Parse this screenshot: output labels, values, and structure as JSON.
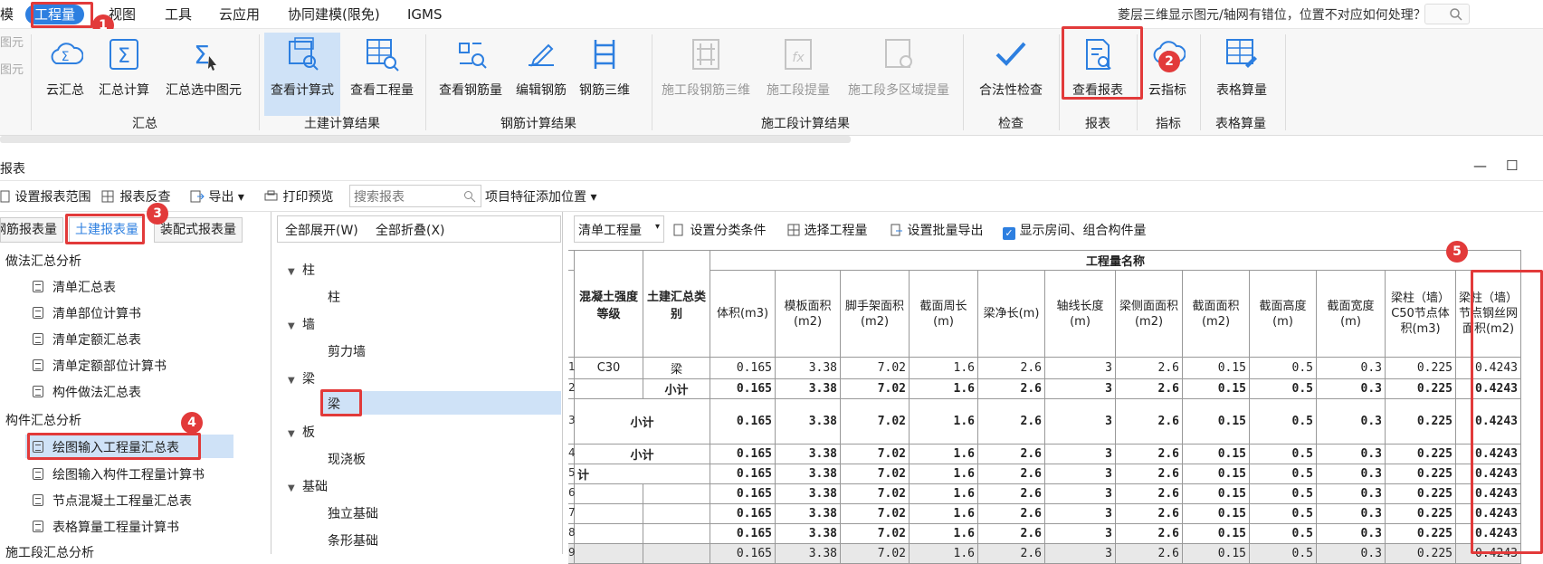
{
  "menubar": {
    "items": [
      "模",
      "工程量",
      "视图",
      "工具",
      "云应用",
      "协同建模(限免)",
      "IGMS"
    ],
    "active_index": 1,
    "notice": "菱层三维显示图元/轴网有错位，位置不对应如何处理？"
  },
  "ribbon": {
    "left_stub": [
      "图元",
      "图元"
    ],
    "buttons": [
      {
        "label": "云汇总",
        "icon": "cloud-sigma-icon"
      },
      {
        "label": "汇总计算",
        "icon": "sigma-icon"
      },
      {
        "label": "汇总选中图元",
        "icon": "sigma-select-icon"
      },
      {
        "label": "查看计算式",
        "icon": "formula-view-icon"
      },
      {
        "label": "查看工程量",
        "icon": "quantity-view-icon"
      },
      {
        "label": "查看钢筋量",
        "icon": "rebar-view-icon"
      },
      {
        "label": "编辑钢筋",
        "icon": "rebar-edit-icon"
      },
      {
        "label": "钢筋三维",
        "icon": "rebar-3d-icon"
      },
      {
        "label": "施工段钢筋三维",
        "icon": "stage-rebar-3d-icon"
      },
      {
        "label": "施工段提量",
        "icon": "stage-fx-icon"
      },
      {
        "label": "施工段多区域提量",
        "icon": "stage-multi-icon"
      },
      {
        "label": "合法性检查",
        "icon": "check-icon"
      },
      {
        "label": "查看报表",
        "icon": "report-icon"
      },
      {
        "label": "云指标",
        "icon": "cloud-index-icon"
      },
      {
        "label": "表格算量",
        "icon": "table-calc-icon"
      }
    ],
    "groups": [
      "汇总",
      "土建计算结果",
      "钢筋计算结果",
      "施工段计算结果",
      "检查",
      "报表",
      "指标",
      "表格算量"
    ]
  },
  "badges": [
    "1",
    "2",
    "3",
    "4",
    "5"
  ],
  "window": {
    "title": "报表",
    "controls": [
      "—",
      "☐"
    ]
  },
  "toolbar": {
    "items": [
      "设置报表范围",
      "报表反查",
      "导出",
      "打印预览"
    ],
    "search_placeholder": "搜索报表",
    "extra": "项目特征添加位置"
  },
  "report_tabs": [
    "钢筋报表量",
    "土建报表量",
    "装配式报表量"
  ],
  "report_tree": {
    "groups": [
      {
        "title": "做法汇总分析",
        "items": [
          "清单汇总表",
          "清单部位计算书",
          "清单定额汇总表",
          "清单定额部位计算书",
          "构件做法汇总表"
        ]
      },
      {
        "title": "构件汇总分析",
        "items": [
          "绘图输入工程量汇总表",
          "绘图输入构件工程量计算书",
          "节点混凝土工程量汇总表",
          "表格算量工程量计算书"
        ]
      }
    ],
    "selected": "绘图输入工程量汇总表",
    "bottom_cut": "施工段汇总分析"
  },
  "component_tree": {
    "expand_all": "全部展开(W)",
    "collapse_all": "全部折叠(X)",
    "nodes": [
      {
        "name": "柱",
        "children": [
          "柱"
        ]
      },
      {
        "name": "墙",
        "children": [
          "剪力墙"
        ]
      },
      {
        "name": "梁",
        "children": [
          "梁"
        ]
      },
      {
        "name": "板",
        "children": [
          "现浇板"
        ]
      },
      {
        "name": "基础",
        "children": [
          "独立基础",
          "条形基础"
        ]
      }
    ]
  },
  "table_toolbar": {
    "dropdown": "清单工程量",
    "set_category": "设置分类条件",
    "select_qty": "选择工程量",
    "batch_export": "设置批量导出",
    "show_rooms": "显示房间、组合构件量"
  },
  "table": {
    "group_header": "工程量名称",
    "col0": "混凝土强度等级",
    "col1": "土建汇总类别",
    "columns": [
      "体积(m3)",
      "模板面积(m2)",
      "脚手架面积(m2)",
      "截面周长(m)",
      "梁净长(m)",
      "轴线长度(m)",
      "梁侧面面积(m2)",
      "截面面积(m2)",
      "截面高度(m)",
      "截面宽度(m)",
      "梁柱（墙）C50节点体积(m3)",
      "梁柱（墙）节点钢丝网面积(m2)"
    ],
    "rows": [
      {
        "n": "1",
        "c0": "C30",
        "c1": "梁",
        "v": [
          "0.165",
          "3.38",
          "7.02",
          "1.6",
          "2.6",
          "3",
          "2.6",
          "0.15",
          "0.5",
          "0.3",
          "0.225",
          "0.4243"
        ],
        "bold": false
      },
      {
        "n": "2",
        "c0": "",
        "c1": "小计",
        "v": [
          "0.165",
          "3.38",
          "7.02",
          "1.6",
          "2.6",
          "3",
          "2.6",
          "0.15",
          "0.5",
          "0.3",
          "0.225",
          "0.4243"
        ],
        "bold": true
      },
      {
        "n": "3",
        "c0": "小计",
        "c1": "",
        "v": [
          "0.165",
          "3.38",
          "7.02",
          "1.6",
          "2.6",
          "3",
          "2.6",
          "0.15",
          "0.5",
          "0.3",
          "0.225",
          "0.4243"
        ],
        "bold": true
      },
      {
        "n": "4",
        "c0": "小计",
        "c1": "",
        "v": [
          "0.165",
          "3.38",
          "7.02",
          "1.6",
          "2.6",
          "3",
          "2.6",
          "0.15",
          "0.5",
          "0.3",
          "0.225",
          "0.4243"
        ],
        "bold": true
      },
      {
        "n": "5",
        "c0": "计",
        "c1": "",
        "v": [
          "0.165",
          "3.38",
          "7.02",
          "1.6",
          "2.6",
          "3",
          "2.6",
          "0.15",
          "0.5",
          "0.3",
          "0.225",
          "0.4243"
        ],
        "bold": true
      },
      {
        "n": "6",
        "c0": "",
        "c1": "",
        "v": [
          "0.165",
          "3.38",
          "7.02",
          "1.6",
          "2.6",
          "3",
          "2.6",
          "0.15",
          "0.5",
          "0.3",
          "0.225",
          "0.4243"
        ],
        "bold": true
      },
      {
        "n": "7",
        "c0": "",
        "c1": "",
        "v": [
          "0.165",
          "3.38",
          "7.02",
          "1.6",
          "2.6",
          "3",
          "2.6",
          "0.15",
          "0.5",
          "0.3",
          "0.225",
          "0.4243"
        ],
        "bold": true
      },
      {
        "n": "8",
        "c0": "",
        "c1": "",
        "v": [
          "0.165",
          "3.38",
          "7.02",
          "1.6",
          "2.6",
          "3",
          "2.6",
          "0.15",
          "0.5",
          "0.3",
          "0.225",
          "0.4243"
        ],
        "bold": true
      },
      {
        "n": "9",
        "c0": "",
        "c1": "",
        "v": [
          "0.165",
          "3.38",
          "7.02",
          "1.6",
          "2.6",
          "3",
          "2.6",
          "0.15",
          "0.5",
          "0.3",
          "0.225",
          "0.4243"
        ],
        "bold": false
      }
    ]
  },
  "colors": {
    "accent": "#2d7fe0",
    "highlight": "#e23a3a",
    "selected_bg": "#cfe2f7"
  }
}
